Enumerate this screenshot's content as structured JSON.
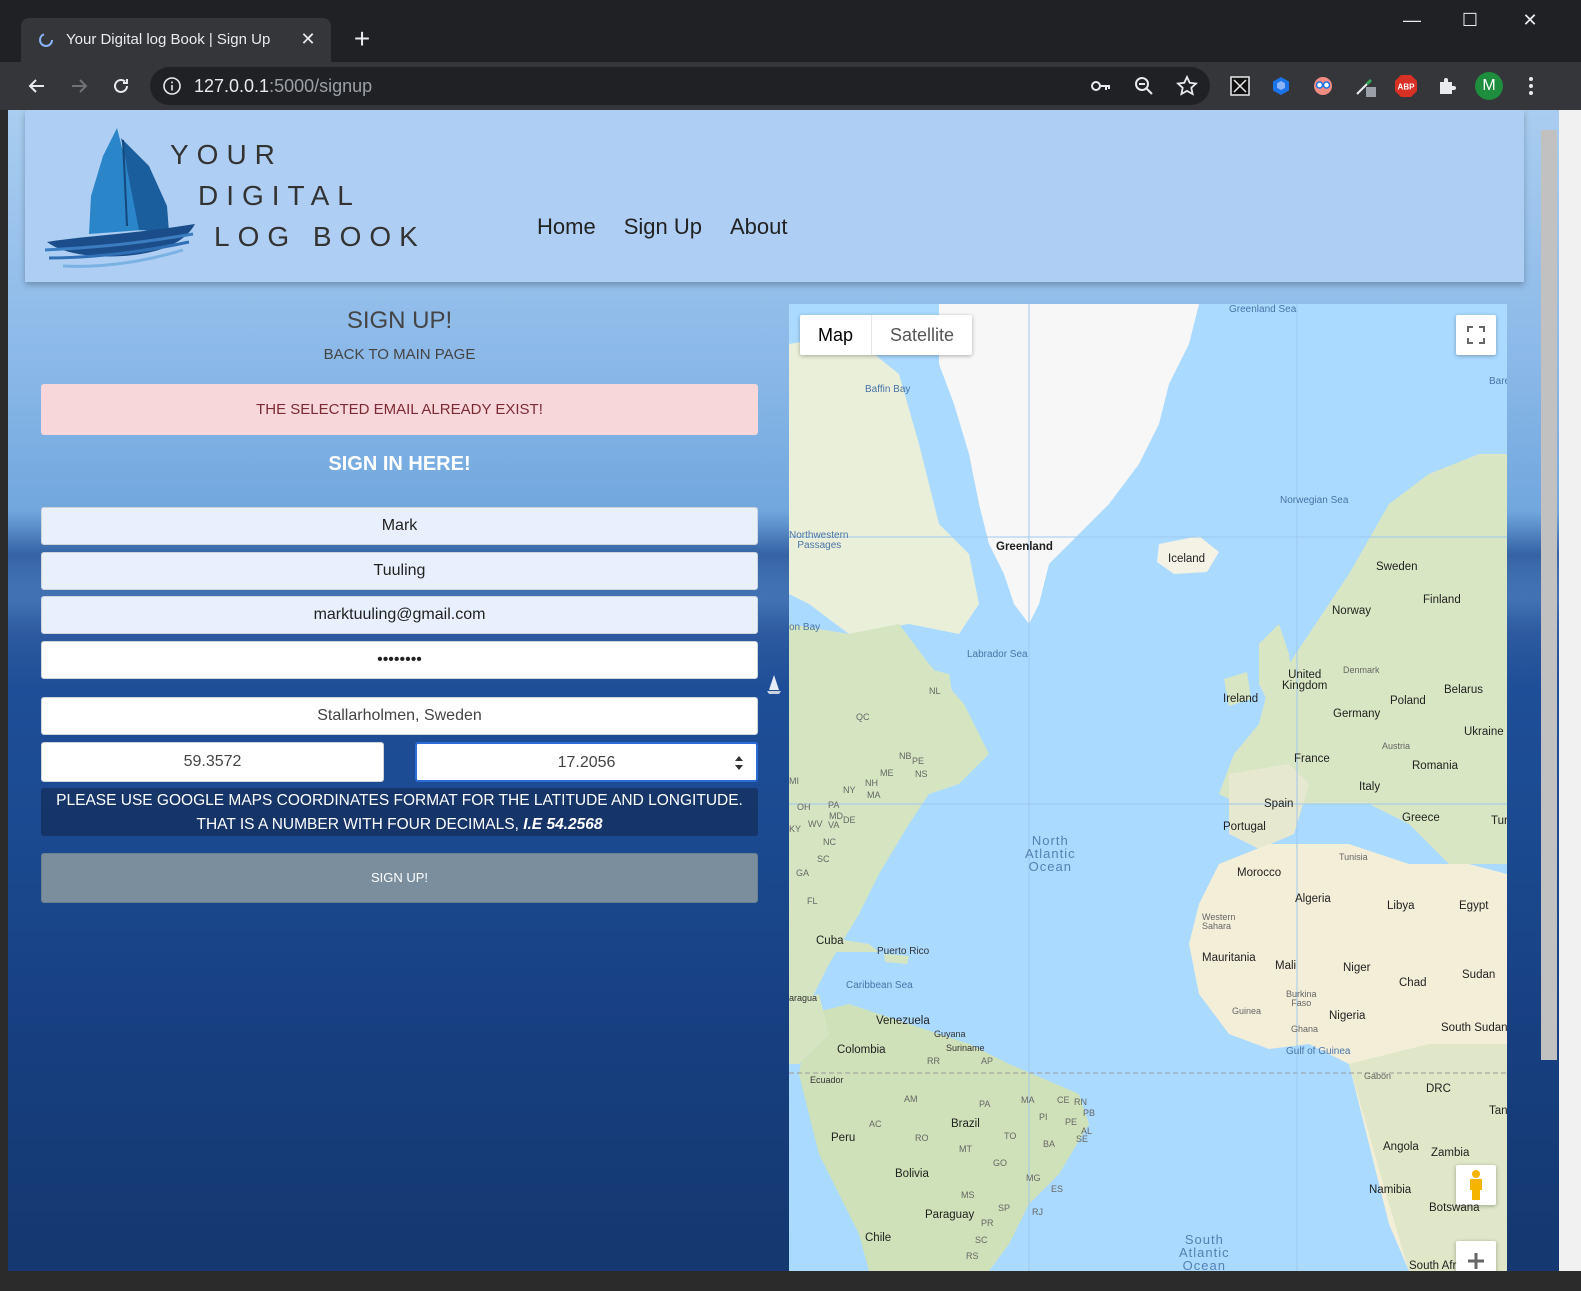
{
  "browser": {
    "tab_title": "Your Digital log Book | Sign Up",
    "url_host": "127.0.0.1",
    "url_rest": ":5000/signup",
    "profile_initial": "M"
  },
  "header": {
    "logo_line1": "YOUR",
    "logo_line2": "DIGITAL",
    "logo_line3": "LOG BOOK",
    "nav": [
      "Home",
      "Sign Up",
      "About"
    ]
  },
  "form": {
    "title": "SIGN UP!",
    "back_link": "BACK TO MAIN PAGE",
    "alert": "THE SELECTED EMAIL ALREADY EXIST!",
    "signin_link": "SIGN IN HERE!",
    "first_name": "Mark",
    "last_name": "Tuuling",
    "email": "marktuuling@gmail.com",
    "password_mask": "••••••••",
    "location": "Stallarholmen, Sweden",
    "latitude": "59.3572",
    "longitude": "17.2056",
    "hint_line1": "PLEASE USE GOOGLE MAPS COORDINATES FORMAT FOR THE LATITUDE AND LONGITUDE.",
    "hint_line2": "THAT IS A NUMBER WITH FOUR DECIMALS, ",
    "hint_example": "I.E 54.2568",
    "submit": "SIGN UP!"
  },
  "map": {
    "type_map": "Map",
    "type_satellite": "Satellite",
    "labels": {
      "greenland_sea": "Greenland Sea",
      "baffin_bay": "Baffin Bay",
      "greenland": "Greenland",
      "iceland": "Iceland",
      "norwegian_sea": "Norwegian Sea",
      "nw_passages_1": "Northwestern",
      "nw_passages_2": "Passages",
      "hudson_bay": "on Bay",
      "labrador_sea": "Labrador Sea",
      "sweden": "Sweden",
      "finland": "Finland",
      "norway": "Norway",
      "denmark": "Denmark",
      "uk_1": "United",
      "uk_2": "Kingdom",
      "ireland": "Ireland",
      "belarus": "Belarus",
      "poland": "Poland",
      "germany": "Germany",
      "ukraine": "Ukraine",
      "austria": "Austria",
      "france": "France",
      "romania": "Romania",
      "italy": "Italy",
      "spain": "Spain",
      "portugal": "Portugal",
      "greece": "Greece",
      "tur": "Tur",
      "tunisia": "Tunisia",
      "morocco": "Morocco",
      "algeria": "Algeria",
      "libya": "Libya",
      "egypt": "Egypt",
      "w_sahara_1": "Western",
      "w_sahara_2": "Sahara",
      "mauritania": "Mauritania",
      "mali": "Mali",
      "niger": "Niger",
      "chad": "Chad",
      "sudan": "Sudan",
      "burkina_1": "Burkina",
      "burkina_2": "Faso",
      "guinea": "Guinea",
      "ghana": "Ghana",
      "nigeria": "Nigeria",
      "south_sudan": "South Sudan",
      "gulf_guinea": "Gulf of Guinea",
      "gabon": "Gabon",
      "drc": "DRC",
      "tanz": "Tanz",
      "angola": "Angola",
      "zambia": "Zambia",
      "namibia": "Namibia",
      "botswana": "Botswana",
      "south_afr": "South Afr",
      "nao_1": "North",
      "nao_2": "Atlantic",
      "nao_3": "Ocean",
      "sao_1": "South",
      "sao_2": "Atlantic",
      "sao_3": "Ocean",
      "cuba": "Cuba",
      "puerto_rico": "Puerto Rico",
      "caribbean": "Caribbean Sea",
      "nicaragua": "aragua",
      "venezuela": "Venezuela",
      "guyana": "Guyana",
      "suriname": "Suriname",
      "colombia": "Colombia",
      "ecuador": "Ecuador",
      "peru": "Peru",
      "brazil": "Brazil",
      "bolivia": "Bolivia",
      "paraguay": "Paraguay",
      "chile": "Chile",
      "barents": "Bare",
      "nl": "NL",
      "qc": "QC",
      "nb": "NB",
      "ns": "NS",
      "pe": "PE",
      "me": "ME",
      "ny": "NY",
      "nh": "NH",
      "ma": "MA",
      "mi": "MI",
      "oh": "OH",
      "pa": "PA",
      "md": "MD",
      "ky": "KY",
      "wv": "WV",
      "va": "VA",
      "de": "DE",
      "nc": "NC",
      "sc": "SC",
      "ga": "GA",
      "fl": "FL",
      "rr": "RR",
      "ap": "AP",
      "am": "AM",
      "pa_br": "PA",
      "ma_br": "MA",
      "ce": "CE",
      "rn": "RN",
      "pb": "PB",
      "pi": "PI",
      "pe_br": "PE",
      "al": "AL",
      "ac": "AC",
      "ro": "RO",
      "to": "TO",
      "ba": "BA",
      "mt": "MT",
      "go": "GO",
      "se": "SE",
      "mg": "MG",
      "es": "ES",
      "ms": "MS",
      "sp": "SP",
      "rj": "RJ",
      "pr": "PR",
      "sc_br": "SC",
      "rs": "RS"
    }
  }
}
